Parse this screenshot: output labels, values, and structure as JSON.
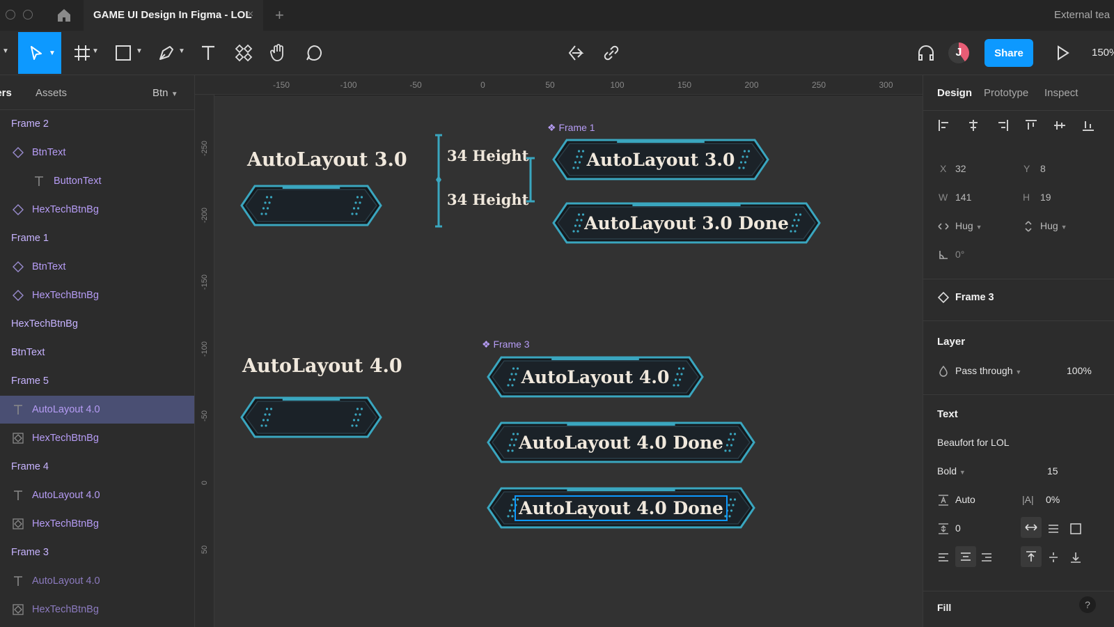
{
  "tabbar": {
    "title": "GAME UI Design In Figma - LOL",
    "close": "×",
    "add": "+",
    "external": "External tea"
  },
  "toolbar": {
    "share": "Share",
    "zoom": "150%",
    "avatar_initial": "J",
    "icons": [
      "move-icon",
      "frame-icon",
      "rectangle-icon",
      "pen-icon",
      "text-icon",
      "components-icon",
      "hand-icon",
      "comment-icon",
      "prototype-icon",
      "link-icon",
      "headphones-icon",
      "play-icon"
    ]
  },
  "left_panel": {
    "tabs": [
      "yers",
      "Assets"
    ],
    "page": "Btn",
    "layers": [
      {
        "label": "Frame 2",
        "type": "frame"
      },
      {
        "label": "BtnText",
        "type": "instance"
      },
      {
        "label": "ButtonText",
        "type": "text"
      },
      {
        "label": "HexTechBtnBg",
        "type": "instance"
      },
      {
        "label": "Frame 1",
        "type": "frame"
      },
      {
        "label": "BtnText",
        "type": "instance"
      },
      {
        "label": "HexTechBtnBg",
        "type": "instance"
      },
      {
        "label": "HexTechBtnBg",
        "type": "frame"
      },
      {
        "label": "BtnText",
        "type": "frame"
      },
      {
        "label": "Frame 5",
        "type": "frame"
      },
      {
        "label": "AutoLayout 4.0",
        "type": "text"
      },
      {
        "label": "HexTechBtnBg",
        "type": "instance-swap"
      },
      {
        "label": "Frame 4",
        "type": "frame"
      },
      {
        "label": "AutoLayout 4.0",
        "type": "text"
      },
      {
        "label": "HexTechBtnBg",
        "type": "instance-swap"
      },
      {
        "label": "Frame 3",
        "type": "frame"
      },
      {
        "label": "AutoLayout 4.0",
        "type": "text"
      },
      {
        "label": "HexTechBtnBg",
        "type": "instance-swap"
      }
    ]
  },
  "rulers": {
    "top": [
      "-150",
      "-100",
      "-50",
      "0",
      "50",
      "100",
      "150",
      "200",
      "250",
      "300"
    ],
    "left": [
      "-250",
      "-200",
      "-150",
      "-100",
      "-50",
      "0",
      "50"
    ]
  },
  "canvas": {
    "heading_a": "AutoLayout 3.0",
    "heading_b": "AutoLayout 4.0",
    "measure_top": "34 Height",
    "measure_bottom": "34 Height",
    "frame1_label": "Frame 1",
    "frame3_label": "Frame 3",
    "btn_1": "AutoLayout 3.0",
    "btn_2": "AutoLayout 3.0 Done",
    "btn_3": "AutoLayout 4.0",
    "btn_4": "AutoLayout 4.0 Done",
    "btn_5": "AutoLayout 4.0 Done",
    "accent": "#3aa6bf",
    "button_fill": "#1b2228"
  },
  "right_panel": {
    "tabs": [
      "Design",
      "Prototype",
      "Inspect"
    ],
    "x_label": "X",
    "x": "32",
    "y_label": "Y",
    "y": "8",
    "w_label": "W",
    "w": "141",
    "h_label": "H",
    "h": "19",
    "width_mode": "Hug",
    "height_mode": "Hug",
    "rotation": "0°",
    "component": "Frame 3",
    "layer_title": "Layer",
    "blend": "Pass through",
    "opacity": "100%",
    "text_title": "Text",
    "font": "Beaufort for LOL",
    "weight": "Bold",
    "size": "15",
    "line_height": "Auto",
    "letter_label": "|A|",
    "letter_spacing": "0%",
    "paragraph": "0",
    "fill_title": "Fill",
    "help": "?"
  }
}
